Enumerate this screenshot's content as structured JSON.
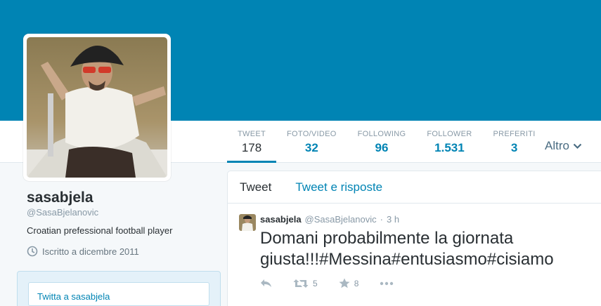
{
  "colors": {
    "banner": "#0084b4",
    "accent": "#0084b4",
    "muted": "#8899a6",
    "text": "#292f33"
  },
  "profile": {
    "name": "sasabjela",
    "handle": "@SasaBjelanovic",
    "bio": "Croatian prefessional football player",
    "joined": "Iscritto a dicembre 2011"
  },
  "stats": [
    {
      "label": "TWEET",
      "value": "178"
    },
    {
      "label": "FOTO/VIDEO",
      "value": "32"
    },
    {
      "label": "FOLLOWING",
      "value": "96"
    },
    {
      "label": "FOLLOWER",
      "value": "1.531"
    },
    {
      "label": "PREFERITI",
      "value": "3"
    }
  ],
  "more": {
    "label": "Altro"
  },
  "tweet_box": {
    "label": "Twitta a sasabjela"
  },
  "timeline": {
    "tabs": [
      "Tweet",
      "Tweet e risposte"
    ],
    "tweet": {
      "name": "sasabjela",
      "handle": "@SasaBjelanovic",
      "separator": "·",
      "time": "3 h",
      "text": "Domani probabilmente la giornata giusta!!!#Messina#entusiasmo#cisiamo",
      "retweets": "5",
      "favorites": "8"
    }
  }
}
